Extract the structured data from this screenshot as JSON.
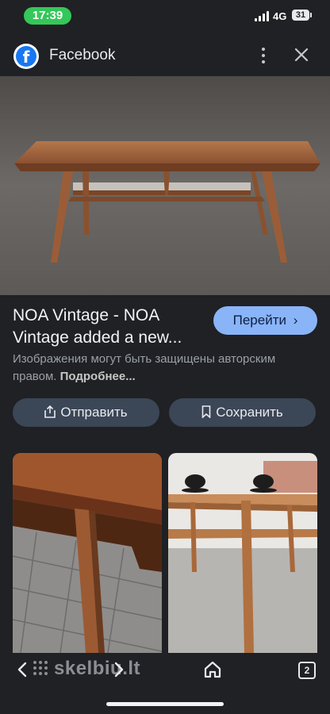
{
  "status_bar": {
    "time": "17:39",
    "network": "4G",
    "battery": "31"
  },
  "header": {
    "app_title": "Facebook",
    "logo_letter": "f",
    "menu_icon": "more-vert-icon",
    "close_icon": "close-icon"
  },
  "hero_image": {
    "alt_subject": "mid-century wooden coffee table"
  },
  "result": {
    "title": "NOA Vintage - NOA Vintage added a new...",
    "go_button_label": "Перейти",
    "copyright_text": "Изображения могут быть защищены авторским правом.",
    "more_link": "Подробнее..."
  },
  "actions": {
    "share_label": "Отправить",
    "save_label": "Сохранить"
  },
  "bottom_bar": {
    "watermark": "skelbiu.lt",
    "tab_count": "2"
  },
  "colors": {
    "background": "#1f2124",
    "accent": "#8ab4f8",
    "pill": "#3b4656",
    "status_green": "#34c759"
  }
}
